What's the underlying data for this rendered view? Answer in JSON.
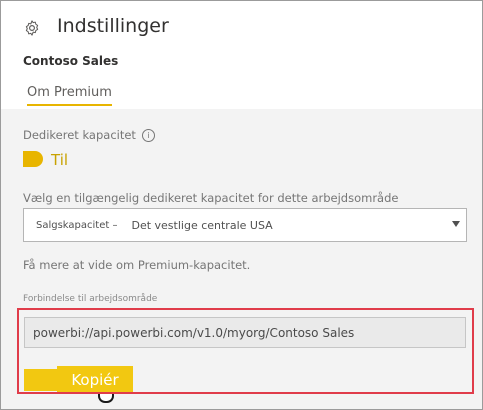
{
  "header": {
    "title": "Indstillinger",
    "workspace_name": "Contoso Sales",
    "tab_label": "Om Premium"
  },
  "dedicated": {
    "label": "Dedikeret kapacitet",
    "info_glyph": "i",
    "toggle_on": true,
    "toggle_label": "Til"
  },
  "capacity_select": {
    "label": "Vælg en tilgængelig dedikeret kapacitet for dette arbejdsområde",
    "selected_name": "Salgskapacitet –",
    "selected_region": "Det vestlige centrale USA"
  },
  "learn_more": "Få mere at vide om Premium-kapacitet.",
  "connection": {
    "label": "Forbindelse til arbejdsområde",
    "value": "powerbi://api.powerbi.com/v1.0/myorg/Contoso Sales",
    "copy_label": "Kopiér"
  },
  "colors": {
    "accent": "#f2c811",
    "highlight_border": "#e03c4a"
  },
  "icons": {
    "settings": "gear-icon",
    "info": "info-icon",
    "dropdown": "chevron-down-icon"
  }
}
